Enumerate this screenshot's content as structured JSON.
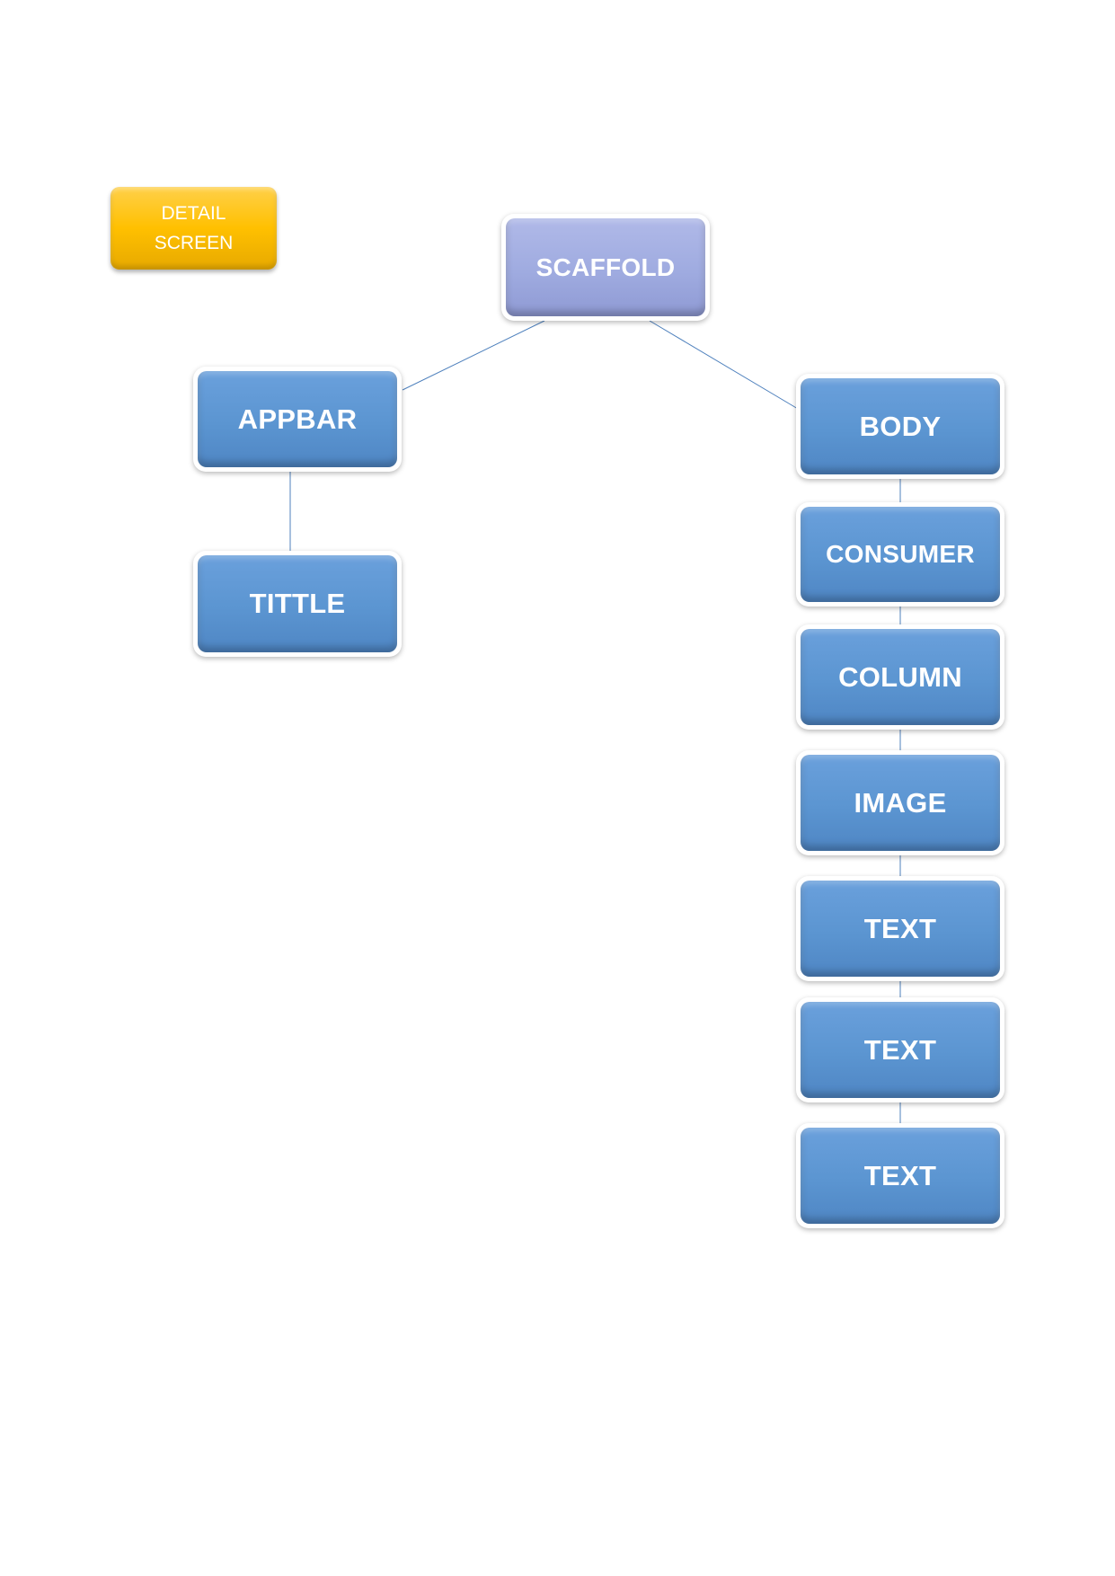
{
  "label": {
    "line1": "DETAIL",
    "line2": "SCREEN"
  },
  "nodes": {
    "scaffold": "SCAFFOLD",
    "appbar": "APPBAR",
    "tittle": "TITTLE",
    "body": "BODY",
    "consumer": "CONSUMER",
    "column": "COLUMN",
    "image": "IMAGE",
    "text1": "TEXT",
    "text2": "TEXT",
    "text3": "TEXT"
  },
  "colors": {
    "node_blue": "#5b95d1",
    "node_lavender": "#9fabe0",
    "label_gold": "#ffc000",
    "connector": "#4f81bd"
  }
}
